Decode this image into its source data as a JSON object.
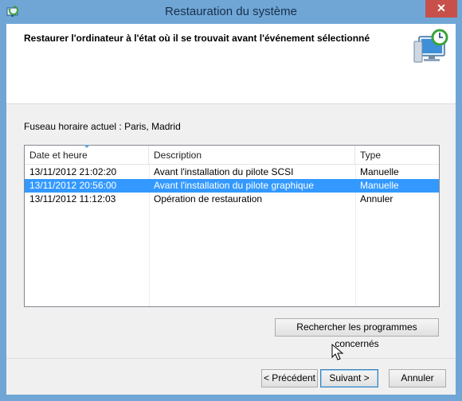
{
  "window": {
    "title": "Restauration du système",
    "close_glyph": "✕"
  },
  "header": {
    "title": "Restaurer l'ordinateur à l'état où il se trouvait avant l'événement sélectionné",
    "icon": "system-restore-icon"
  },
  "timezone_label": "Fuseau horaire actuel : Paris, Madrid",
  "list": {
    "columns": [
      "Date et heure",
      "Description",
      "Type"
    ],
    "rows": [
      {
        "date": "13/11/2012 21:02:20",
        "description": "Avant l'installation du pilote SCSI",
        "type": "Manuelle",
        "selected": false
      },
      {
        "date": "13/11/2012 20:56:00",
        "description": "Avant l'installation du pilote graphique",
        "type": "Manuelle",
        "selected": true
      },
      {
        "date": "13/11/2012 11:12:03",
        "description": "Opération de restauration",
        "type": "Annuler",
        "selected": false
      }
    ]
  },
  "buttons": {
    "scan": "Rechercher les programmes concernés",
    "back": "< Précédent",
    "next": "Suivant >",
    "cancel": "Annuler"
  },
  "colors": {
    "titlebar": "#6fa6d6",
    "selection": "#3399ff",
    "close": "#c7504b"
  }
}
